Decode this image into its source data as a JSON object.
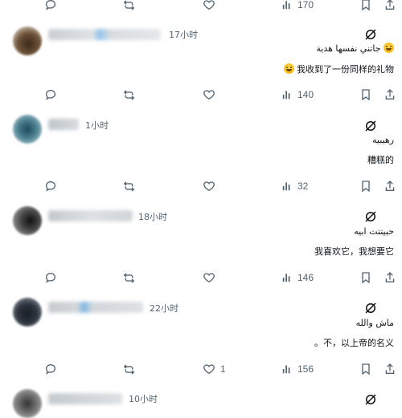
{
  "threads": [
    {
      "stats": {
        "views": "170"
      }
    },
    {
      "time": "17小时",
      "lines": [
        "جاتني نفسها هدية",
        "我收到了一份同样的礼物"
      ],
      "emoji_lines": [
        0,
        1
      ],
      "stats": {
        "views": "140"
      }
    },
    {
      "time": "1小时",
      "lines": [
        "رهيبيه",
        "糟糕的"
      ],
      "stats": {
        "views": "32"
      }
    },
    {
      "time": "18小时",
      "lines": [
        "حبيتتت ابيه",
        "我喜欢它，我想要它"
      ],
      "stats": {
        "views": "146"
      }
    },
    {
      "time": "22小时",
      "lines": [
        "ماش والله",
        "。不，以上帝的名义"
      ],
      "stats": {
        "likes": "1",
        "views": "156"
      }
    },
    {
      "time": "10小时"
    }
  ],
  "icons": {
    "reply": "reply-icon",
    "repost": "repost-icon",
    "like": "heart-icon",
    "views": "views-icon",
    "bookmark": "bookmark-icon",
    "share": "share-icon",
    "grok": "grok-icon"
  },
  "colors": {
    "muted": "#536471",
    "text": "#0f1419",
    "emoji": "#f7b500"
  }
}
